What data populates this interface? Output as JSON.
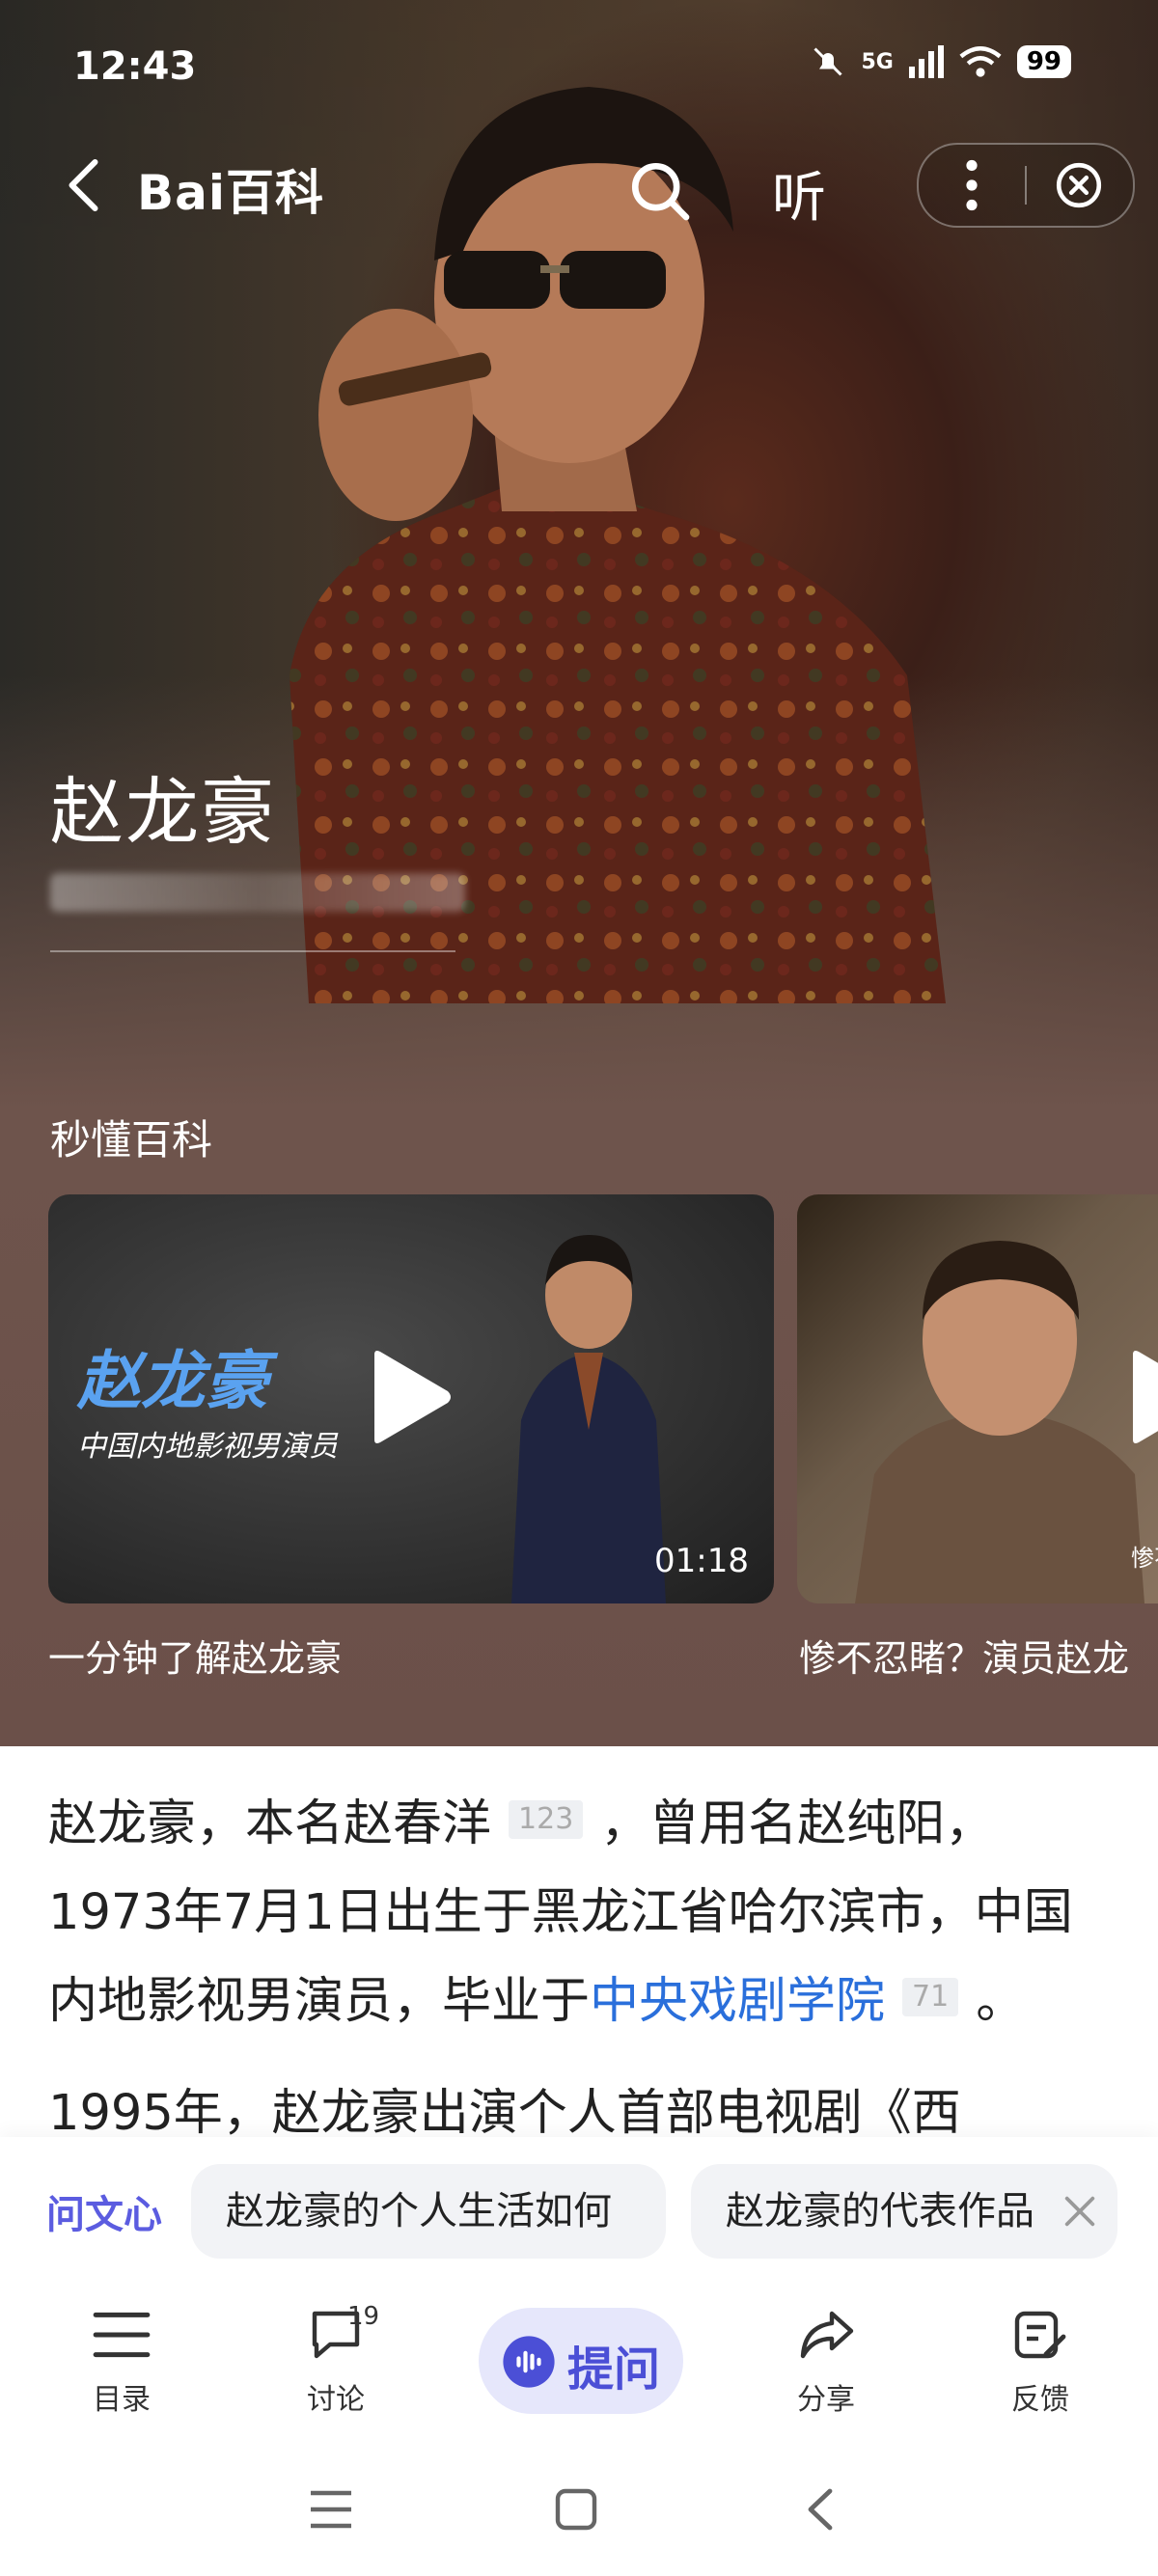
{
  "status_bar": {
    "time": "12:43",
    "network": "5G",
    "battery": "99"
  },
  "topbar": {
    "logo": "Bai百科",
    "logo_du": "du",
    "listen": "听"
  },
  "hero": {
    "name": "赵龙豪",
    "section_title": "秒懂百科"
  },
  "videos": [
    {
      "title_overlay": "赵龙豪",
      "subtitle_overlay": "中国内地影视男演员",
      "duration": "01:18",
      "caption": "一分钟了解赵龙豪"
    },
    {
      "overlay_text": "惨不",
      "caption": "惨不忍睹？演员赵龙"
    }
  ],
  "article": {
    "p1_a": "赵龙豪，本名赵春洋",
    "cite1": "123",
    "p1_b": "，曾用名赵纯阳，1973年7月1日出生于黑龙江省哈尔滨市，中国内地影视男演员，毕业于",
    "link1": "中央戏剧学院",
    "cite2": "71",
    "p1_c": "。",
    "p2": "1995年，赵龙豪出演个人首部电视剧《西"
  },
  "question_bar": {
    "brand": "问文心",
    "chips": [
      "赵龙豪的个人生活如何",
      "赵龙豪的代表作品"
    ]
  },
  "bottom_nav": {
    "toc": "目录",
    "discuss": "讨论",
    "discuss_count": "19",
    "ask": "提问",
    "share": "分享",
    "feedback": "反馈"
  },
  "colors": {
    "accent": "#4b4fd6",
    "link": "#2a6fdb",
    "hero_bottom": "#6b5049"
  }
}
